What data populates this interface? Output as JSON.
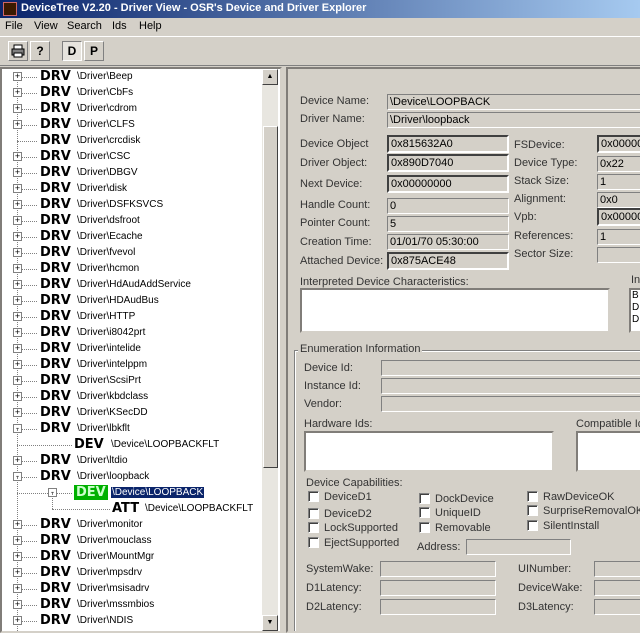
{
  "window": {
    "title": "DeviceTree V2.20 - Driver View - OSR's Device and Driver Explorer"
  },
  "menu": [
    "File",
    "View",
    "Search",
    "Ids",
    "Help"
  ],
  "toolbar": {
    "print_icon": "printer-icon",
    "help_icon": "question-icon",
    "d_label": "D",
    "p_label": "P"
  },
  "tree": {
    "items": [
      {
        "kind": "DRV",
        "path": "\\Driver\\Beep",
        "expander": "+"
      },
      {
        "kind": "DRV",
        "path": "\\Driver\\CbFs",
        "expander": "+"
      },
      {
        "kind": "DRV",
        "path": "\\Driver\\cdrom",
        "expander": "+"
      },
      {
        "kind": "DRV",
        "path": "\\Driver\\CLFS",
        "expander": "+"
      },
      {
        "kind": "DRV",
        "path": "\\Driver\\crcdisk",
        "expander": ""
      },
      {
        "kind": "DRV",
        "path": "\\Driver\\CSC",
        "expander": "+"
      },
      {
        "kind": "DRV",
        "path": "\\Driver\\DBGV",
        "expander": "+"
      },
      {
        "kind": "DRV",
        "path": "\\Driver\\disk",
        "expander": "+"
      },
      {
        "kind": "DRV",
        "path": "\\Driver\\DSFKSVCS",
        "expander": "+"
      },
      {
        "kind": "DRV",
        "path": "\\Driver\\dsfroot",
        "expander": "+"
      },
      {
        "kind": "DRV",
        "path": "\\Driver\\Ecache",
        "expander": "+"
      },
      {
        "kind": "DRV",
        "path": "\\Driver\\fvevol",
        "expander": "+"
      },
      {
        "kind": "DRV",
        "path": "\\Driver\\hcmon",
        "expander": "+"
      },
      {
        "kind": "DRV",
        "path": "\\Driver\\HdAudAddService",
        "expander": "+"
      },
      {
        "kind": "DRV",
        "path": "\\Driver\\HDAudBus",
        "expander": "+"
      },
      {
        "kind": "DRV",
        "path": "\\Driver\\HTTP",
        "expander": "+"
      },
      {
        "kind": "DRV",
        "path": "\\Driver\\i8042prt",
        "expander": "+"
      },
      {
        "kind": "DRV",
        "path": "\\Driver\\intelide",
        "expander": "+"
      },
      {
        "kind": "DRV",
        "path": "\\Driver\\intelppm",
        "expander": "+"
      },
      {
        "kind": "DRV",
        "path": "\\Driver\\ScsiPrt",
        "expander": "+"
      },
      {
        "kind": "DRV",
        "path": "\\Driver\\kbdclass",
        "expander": "+"
      },
      {
        "kind": "DRV",
        "path": "\\Driver\\KSecDD",
        "expander": "+"
      },
      {
        "kind": "DRV",
        "path": "\\Driver\\lbkflt",
        "expander": "-"
      },
      {
        "kind": "DEV",
        "path": "\\Device\\LOOPBACKFLT",
        "expander": ""
      },
      {
        "kind": "DRV",
        "path": "\\Driver\\ltdio",
        "expander": "+"
      },
      {
        "kind": "DRV",
        "path": "\\Driver\\loopback",
        "expander": "-"
      },
      {
        "kind": "DEV",
        "path": "\\Device\\LOOPBACK",
        "expander": "-",
        "selected": true
      },
      {
        "kind": "ATT",
        "path": "\\Device\\LOOPBACKFLT",
        "expander": ""
      },
      {
        "kind": "DRV",
        "path": "\\Driver\\monitor",
        "expander": "+"
      },
      {
        "kind": "DRV",
        "path": "\\Driver\\mouclass",
        "expander": "+"
      },
      {
        "kind": "DRV",
        "path": "\\Driver\\MountMgr",
        "expander": "+"
      },
      {
        "kind": "DRV",
        "path": "\\Driver\\mpsdrv",
        "expander": "+"
      },
      {
        "kind": "DRV",
        "path": "\\Driver\\msisadrv",
        "expander": "+"
      },
      {
        "kind": "DRV",
        "path": "\\Driver\\mssmbios",
        "expander": "+"
      },
      {
        "kind": "DRV",
        "path": "\\Driver\\NDIS",
        "expander": "+"
      }
    ]
  },
  "details": {
    "device_name_label": "Device Name:",
    "device_name": "\\Device\\LOOPBACK",
    "driver_name_label": "Driver Name:",
    "driver_name": "\\Driver\\loopback",
    "device_object_label": "Device Object",
    "device_object": "0x815632A0",
    "driver_object_label": "Driver Object:",
    "driver_object": "0x890D7040",
    "next_device_label": "Next Device:",
    "next_device": "0x00000000",
    "handle_count_label": "Handle Count:",
    "handle_count": "0",
    "pointer_count_label": "Pointer Count:",
    "pointer_count": "5",
    "creation_time_label": "Creation Time:",
    "creation_time": "01/01/70 05:30:00",
    "attached_device_label": "Attached Device:",
    "attached_device": "0x875ACE48",
    "fsdevice_label": "FSDevice:",
    "fsdevice": "0x00000",
    "device_type_label": "Device Type:",
    "device_type": "0x22",
    "stack_size_label": "Stack Size:",
    "stack_size": "1",
    "alignment_label": "Alignment:",
    "alignment": "0x0",
    "vpb_label": "Vpb:",
    "vpb": "0x00000",
    "references_label": "References:",
    "references": "1",
    "sector_size_label": "Sector Size:",
    "sector_size": "",
    "interpreted_chars_label": "Interpreted Device Characteristics:",
    "right_partial_label": "In",
    "right_partial_lines": [
      "B",
      "D",
      "D"
    ]
  },
  "enumeration": {
    "group_label": "Enumeration Information",
    "device_id_label": "Device Id:",
    "instance_id_label": "Instance Id:",
    "vendor_label": "Vendor:",
    "hardware_ids_label": "Hardware Ids:",
    "compatible_ids_label": "Compatible Id",
    "capabilities_label": "Device Capabilities:",
    "capabilities": [
      "DeviceD1",
      "DeviceD2",
      "LockSupported",
      "EjectSupported",
      "DockDevice",
      "UniqueID",
      "Removable",
      "RawDeviceOK",
      "SurpriseRemovalOK",
      "SilentInstall"
    ],
    "address_label": "Address:",
    "system_wake_label": "SystemWake:",
    "d1_latency_label": "D1Latency:",
    "d2_latency_label": "D2Latency:",
    "ui_number_label": "UINumber:",
    "device_wake_label": "DeviceWake:",
    "d3_latency_label": "D3Latency:"
  }
}
